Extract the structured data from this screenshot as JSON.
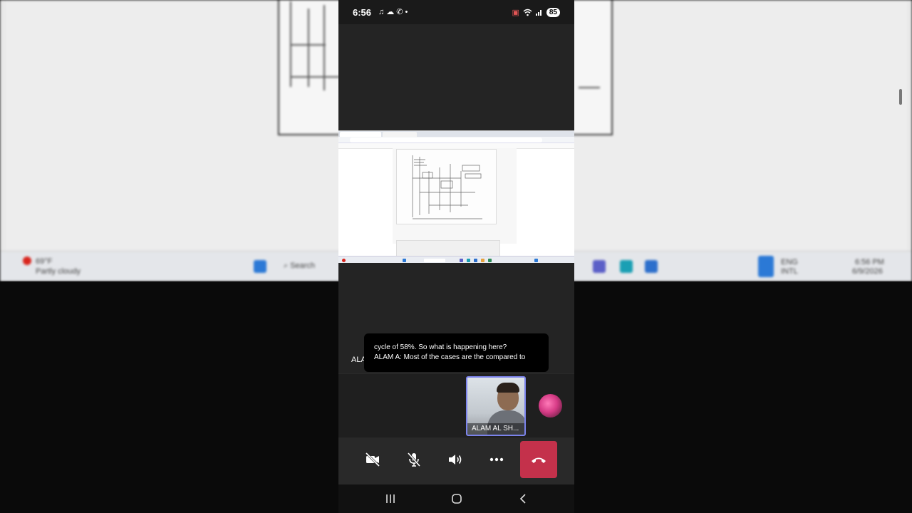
{
  "status_bar": {
    "time": "6:56",
    "left_icons": [
      "music-icon",
      "cloud-icon",
      "phone-icon",
      "dot-icon"
    ],
    "right_icons": [
      "cast-icon",
      "wifi-icon",
      "signal-icon"
    ],
    "battery": "85"
  },
  "shared_screen": {
    "description_icons": [
      "browser-tab-icon",
      "pdf-icon"
    ],
    "accent": "#d9251d"
  },
  "caption": {
    "speaker_prefix": "ALAM",
    "line1": "cycle of 58%. So what is happening here?",
    "line2": "ALAM A: Most of the cases are the compared to"
  },
  "participants": {
    "tile_label": "ALAM AL SH...",
    "highlight_color": "#7b83eb"
  },
  "controls": {
    "camera": "camera-off-icon",
    "mic": "mic-off-icon",
    "speaker": "speaker-icon",
    "more": "more-icon",
    "end": "end-call-icon",
    "end_color": "#c4314b"
  },
  "navigation": {
    "recent": "recent-apps-icon",
    "home": "home-icon",
    "back": "back-icon"
  }
}
